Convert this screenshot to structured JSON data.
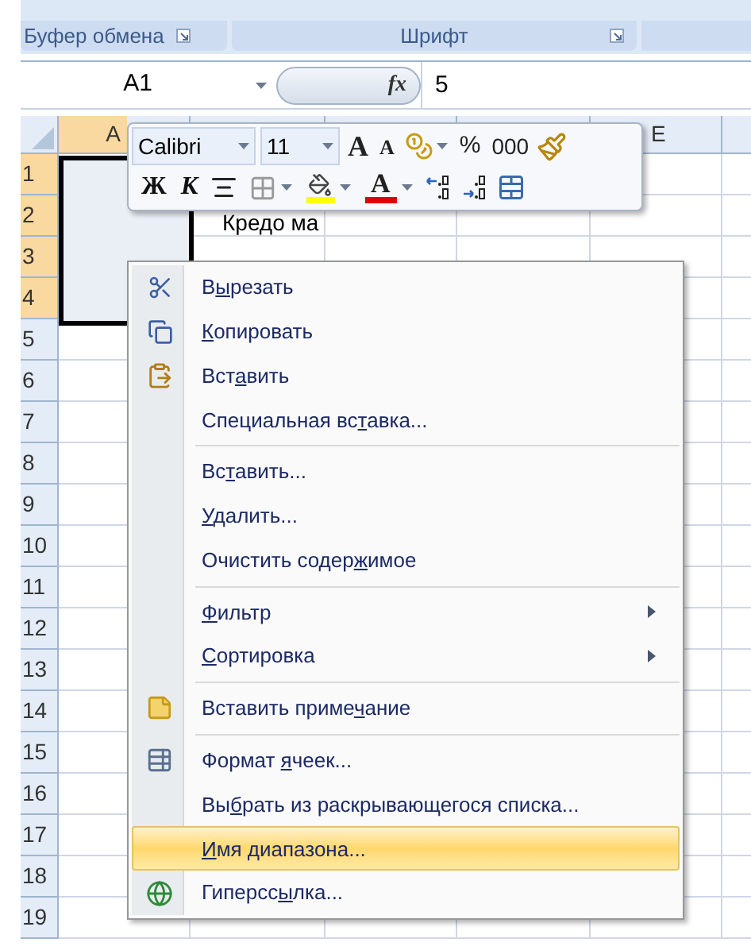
{
  "ribbon_groups": [
    {
      "label": "Буфер обмена"
    },
    {
      "label": "Шрифт"
    }
  ],
  "formula_bar": {
    "name_box": "A1",
    "function_label": "fx",
    "value": "5"
  },
  "column_headers": [
    {
      "label": "A",
      "selected": true
    },
    {
      "label": "E",
      "selected": false
    }
  ],
  "rows": [
    {
      "label": "1",
      "selected": true
    },
    {
      "label": "2",
      "selected": true,
      "column_b": "Кредо ма"
    },
    {
      "label": "3",
      "selected": true
    },
    {
      "label": "4",
      "selected": true
    },
    {
      "label": "5",
      "selected": false
    },
    {
      "label": "6",
      "selected": false
    },
    {
      "label": "7",
      "selected": false
    },
    {
      "label": "8",
      "selected": false
    },
    {
      "label": "9",
      "selected": false
    },
    {
      "label": "10",
      "selected": false
    },
    {
      "label": "11",
      "selected": false
    },
    {
      "label": "12",
      "selected": false
    },
    {
      "label": "13",
      "selected": false
    },
    {
      "label": "14",
      "selected": false
    },
    {
      "label": "15",
      "selected": false
    },
    {
      "label": "16",
      "selected": false
    },
    {
      "label": "17",
      "selected": false
    },
    {
      "label": "18",
      "selected": false
    },
    {
      "label": "19",
      "selected": false
    }
  ],
  "mini_toolbar": {
    "font": "Calibri",
    "size": "11",
    "grow_font": "A",
    "shrink_font": "A",
    "percent": "%",
    "thousands": "000",
    "bold": "Ж",
    "italic": "К",
    "font_color": "A"
  },
  "context_menu": [
    {
      "kind": "item",
      "text_before": "В",
      "accel": "ы",
      "text_after": "резать",
      "submenu": false,
      "selected": false
    },
    {
      "kind": "item",
      "accel": "К",
      "text_after": "опировать",
      "submenu": false,
      "selected": false
    },
    {
      "kind": "item",
      "text_before": "Вст",
      "accel": "а",
      "text_after": "вить",
      "submenu": false,
      "selected": false
    },
    {
      "kind": "item",
      "text_before": "Специальная вс",
      "accel": "т",
      "text_after": "авка...",
      "submenu": false,
      "selected": false
    },
    {
      "kind": "separator"
    },
    {
      "kind": "item",
      "text_before": "Вс",
      "accel": "т",
      "text_after": "авить...",
      "submenu": false,
      "selected": false
    },
    {
      "kind": "item",
      "accel": "У",
      "text_after": "далить...",
      "submenu": false,
      "selected": false
    },
    {
      "kind": "item",
      "text_before": "Очистить содер",
      "accel": "ж",
      "text_after": "имое",
      "submenu": false,
      "selected": false
    },
    {
      "kind": "separator"
    },
    {
      "kind": "item",
      "accel": "Ф",
      "text_after": "ильтр",
      "submenu": true,
      "selected": false
    },
    {
      "kind": "item",
      "accel": "С",
      "text_after": "ортировка",
      "submenu": true,
      "selected": false
    },
    {
      "kind": "separator"
    },
    {
      "kind": "item",
      "text_before": "Вставить приме",
      "accel": "ч",
      "text_after": "ание",
      "submenu": false,
      "selected": false
    },
    {
      "kind": "separator"
    },
    {
      "kind": "item",
      "text_before": "Формат ",
      "accel": "я",
      "text_after": "чеек...",
      "submenu": false,
      "selected": false
    },
    {
      "kind": "item",
      "text_before": "Вы",
      "accel": "б",
      "text_after": "рать из раскрывающегося списка...",
      "submenu": false,
      "selected": false
    },
    {
      "kind": "item",
      "accel": "И",
      "text_after": "мя диапазона...",
      "submenu": false,
      "selected": true
    },
    {
      "kind": "item",
      "text_before": "Гиперсс",
      "accel": "ы",
      "text_after": "лка...",
      "submenu": false,
      "selected": false
    }
  ]
}
